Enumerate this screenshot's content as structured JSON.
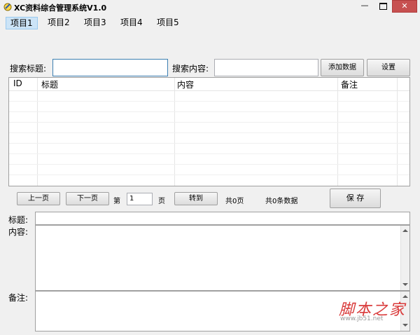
{
  "window": {
    "title": "XC资料综合管理系统V1.0",
    "close_glyph": "✕",
    "minimize_glyph": "—"
  },
  "menu": [
    {
      "label": "项目1",
      "active": true
    },
    {
      "label": "项目2"
    },
    {
      "label": "项目3"
    },
    {
      "label": "项目4"
    },
    {
      "label": "项目5"
    }
  ],
  "search": {
    "title_label": "搜索标题:",
    "content_label": "搜索内容:",
    "title_value": "",
    "content_value": ""
  },
  "buttons": {
    "add": "添加数据",
    "settings": "设置",
    "prev": "上一页",
    "next": "下一页",
    "goto": "转到",
    "save": "保 存"
  },
  "table": {
    "columns": [
      "ID",
      "标题",
      "内容",
      "备注"
    ],
    "rows": []
  },
  "pager": {
    "page_prefix": "第",
    "page_value": "1",
    "page_suffix": "页",
    "total_pages": "共0页",
    "total_records": "共0条数据"
  },
  "editor": {
    "title_label": "标题:",
    "content_label": "内容:",
    "note_label": "备注:",
    "title_value": "",
    "content_value": "",
    "note_value": ""
  },
  "watermark": {
    "brand": "脚本之家",
    "url": "www.jb51.net"
  },
  "colors": {
    "close_button": "#c75050",
    "active_menu": "#cce4f7",
    "focus_border": "#3c7fb1"
  }
}
